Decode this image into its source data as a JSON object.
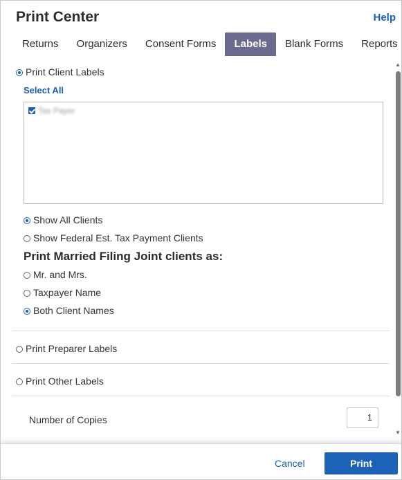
{
  "header": {
    "title": "Print Center",
    "help_label": "Help"
  },
  "tabs": [
    {
      "label": "Returns",
      "active": false
    },
    {
      "label": "Organizers",
      "active": false
    },
    {
      "label": "Consent Forms",
      "active": false
    },
    {
      "label": "Labels",
      "active": true
    },
    {
      "label": "Blank Forms",
      "active": false
    },
    {
      "label": "Reports",
      "active": false
    }
  ],
  "client_labels": {
    "option_label": "Print Client Labels",
    "checked": true,
    "select_all_label": "Select All",
    "clients": [
      {
        "name": "Tax Payer",
        "checked": true,
        "blurred": true
      }
    ],
    "filter_options": [
      {
        "label": "Show All Clients",
        "checked": true
      },
      {
        "label": "Show Federal Est. Tax Payment Clients",
        "checked": false
      }
    ],
    "mfj_heading": "Print Married Filing Joint clients as:",
    "mfj_options": [
      {
        "label": "Mr. and Mrs.",
        "checked": false
      },
      {
        "label": "Taxpayer Name",
        "checked": false
      },
      {
        "label": "Both Client Names",
        "checked": true
      }
    ]
  },
  "preparer_labels": {
    "option_label": "Print Preparer Labels",
    "checked": false
  },
  "other_labels": {
    "option_label": "Print Other Labels",
    "checked": false
  },
  "copies": {
    "label": "Number of Copies",
    "value": "1"
  },
  "footer": {
    "cancel_label": "Cancel",
    "print_label": "Print"
  },
  "colors": {
    "accent": "#1a5fb4",
    "active_tab": "#6b6b8f",
    "print_button": "#1c63b8"
  }
}
